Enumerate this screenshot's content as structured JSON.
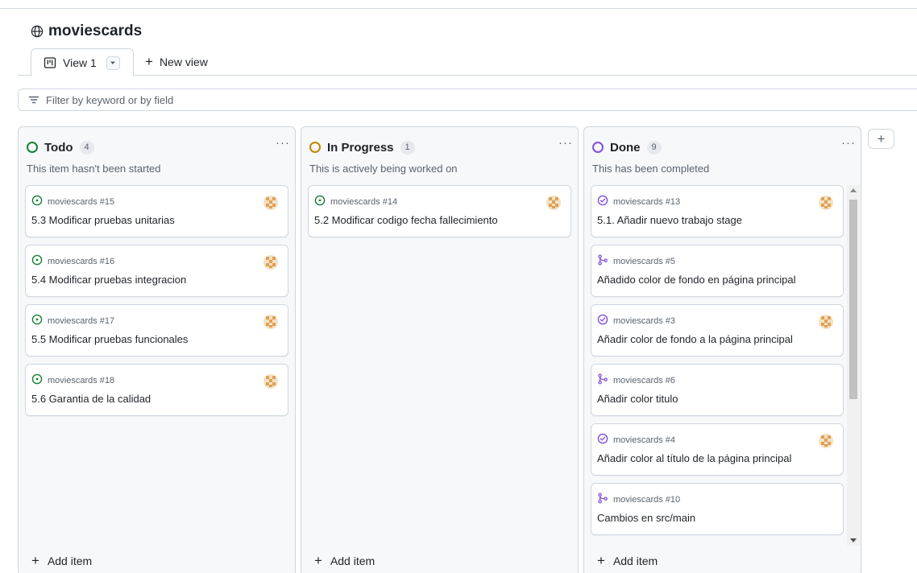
{
  "project": {
    "title": "moviescards"
  },
  "tabs": {
    "view_label": "View 1",
    "new_view_label": "New view"
  },
  "filter": {
    "placeholder": "Filter by keyword or by field"
  },
  "colors": {
    "todo": "#1a7f37",
    "in_progress": "#bf8700",
    "done": "#8250df",
    "pr": "#8250df"
  },
  "columns": [
    {
      "name": "Todo",
      "count": "4",
      "description": "This item hasn't been started",
      "menu": "···",
      "add_label": "Add item",
      "cards": [
        {
          "repo": "moviescards #15",
          "title": "5.3 Modificar pruebas unitarias",
          "icon": "issue-open-icon",
          "avatar": true
        },
        {
          "repo": "moviescards #16",
          "title": "5.4 Modificar pruebas integracion",
          "icon": "issue-open-icon",
          "avatar": true
        },
        {
          "repo": "moviescards #17",
          "title": "5.5 Modificar pruebas funcionales",
          "icon": "issue-open-icon",
          "avatar": true
        },
        {
          "repo": "moviescards #18",
          "title": "5.6 Garantia de la calidad",
          "icon": "issue-open-icon",
          "avatar": true
        }
      ]
    },
    {
      "name": "In Progress",
      "count": "1",
      "description": "This is actively being worked on",
      "menu": "···",
      "add_label": "Add item",
      "cards": [
        {
          "repo": "moviescards #14",
          "title": "5.2 Modificar codigo fecha fallecimiento",
          "icon": "issue-open-icon",
          "avatar": true
        }
      ]
    },
    {
      "name": "Done",
      "count": "9",
      "description": "This has been completed",
      "menu": "···",
      "add_label": "Add item",
      "cards": [
        {
          "repo": "moviescards #13",
          "title": "5.1. Añadir nuevo trabajo stage",
          "icon": "issue-closed-icon",
          "avatar": true
        },
        {
          "repo": "moviescards #5",
          "title": "Añadido color de fondo en página principal",
          "icon": "pull-request-merged-icon",
          "avatar": false
        },
        {
          "repo": "moviescards #3",
          "title": "Añadir color de fondo a la página principal",
          "icon": "issue-closed-icon",
          "avatar": true
        },
        {
          "repo": "moviescards #6",
          "title": "Añadir color titulo",
          "icon": "pull-request-merged-icon",
          "avatar": false
        },
        {
          "repo": "moviescards #4",
          "title": "Añadir color al título de la página principal",
          "icon": "issue-closed-icon",
          "avatar": true
        },
        {
          "repo": "moviescards #10",
          "title": "Cambios en src/main",
          "icon": "pull-request-merged-icon",
          "avatar": false
        }
      ]
    }
  ]
}
